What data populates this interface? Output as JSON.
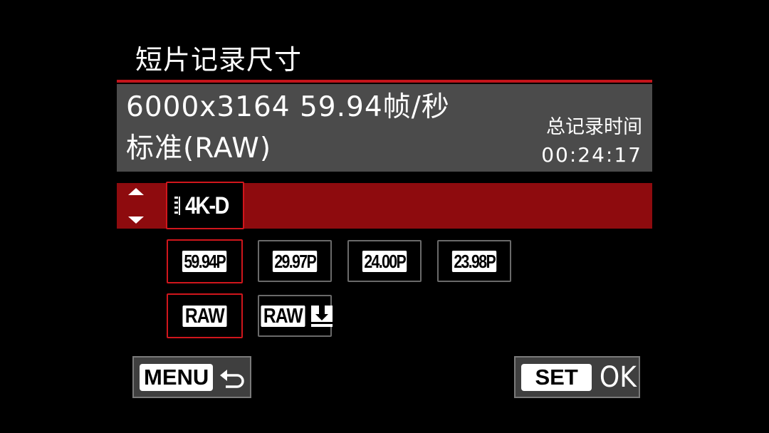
{
  "header": {
    "title": "短片记录尺寸"
  },
  "info": {
    "line1": "6000x3164 59.94帧/秒",
    "line2": "标准(RAW)",
    "total_time_label": "总记录时间",
    "total_time": "00:24:17"
  },
  "size_option": {
    "label": "4K-D",
    "icon": "movie-4k-icon"
  },
  "frame_rates": [
    {
      "label": "59.94P",
      "selected": true
    },
    {
      "label": "29.97P",
      "selected": false
    },
    {
      "label": "24.00P",
      "selected": false
    },
    {
      "label": "23.98P",
      "selected": false
    }
  ],
  "quality": [
    {
      "label": "RAW",
      "selected": true
    },
    {
      "label": "RAW",
      "icon": "download-light-icon",
      "selected": false
    }
  ],
  "buttons": {
    "menu_label": "MENU",
    "menu_icon": "return-arrow-icon",
    "set_label": "SET",
    "ok_label": "OK"
  },
  "colors": {
    "accent_red": "#c4141b",
    "row_highlight": "#8e0b0e",
    "panel_gray": "#4b4b4b"
  }
}
